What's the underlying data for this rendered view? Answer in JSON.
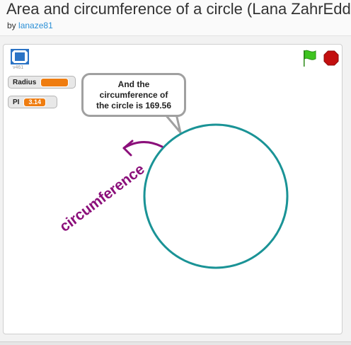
{
  "header": {
    "title": "Area and circumference of a circle (Lana ZahrEddin)",
    "by_label": "by",
    "author": "lanaze81"
  },
  "player": {
    "version": "v461",
    "icons": {
      "fullscreen": "fullscreen-icon",
      "flag": "green-flag-icon",
      "stop": "stop-icon"
    },
    "colors": {
      "flag": "#2fbf1c",
      "stop": "#c30f0f",
      "monitor_value": "#ef7d11",
      "circle": "#1a9396",
      "handwriting": "#8b0f7a"
    }
  },
  "monitors": [
    {
      "name": "Radius",
      "value": ""
    },
    {
      "name": "PI",
      "value": "3.14"
    }
  ],
  "speech_bubble": {
    "text": "And the\ncircumference of\nthe circle is 169.56"
  },
  "drawing": {
    "label": "circumference"
  }
}
